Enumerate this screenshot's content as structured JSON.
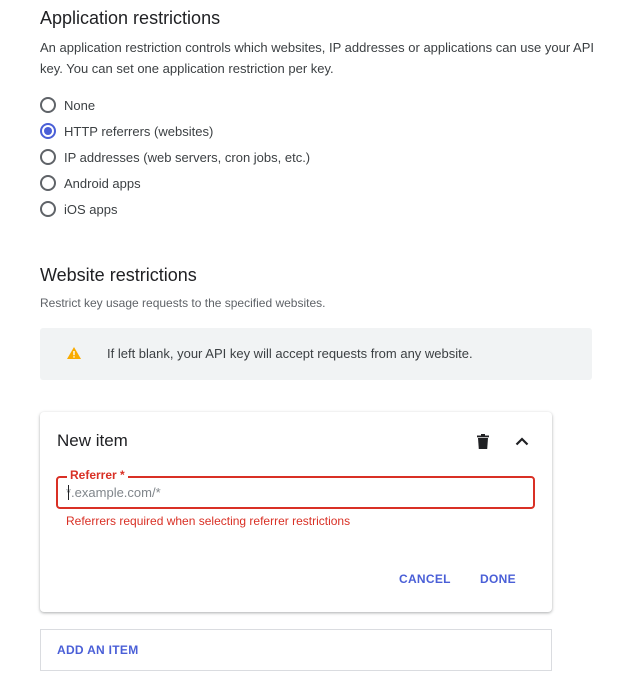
{
  "app_restrictions": {
    "title": "Application restrictions",
    "description": "An application restriction controls which websites, IP addresses or applications can use your API key. You can set one application restriction per key.",
    "options": [
      {
        "label": "None",
        "selected": false
      },
      {
        "label": "HTTP referrers (websites)",
        "selected": true
      },
      {
        "label": "IP addresses (web servers, cron jobs, etc.)",
        "selected": false
      },
      {
        "label": "Android apps",
        "selected": false
      },
      {
        "label": "iOS apps",
        "selected": false
      }
    ]
  },
  "website_restrictions": {
    "title": "Website restrictions",
    "description": "Restrict key usage requests to the specified websites.",
    "warning": {
      "icon": "warning-icon",
      "text": "If left blank, your API key will accept requests from any website."
    }
  },
  "item_card": {
    "title": "New item",
    "delete_icon": "trash-icon",
    "collapse_icon": "chevron-up-icon",
    "referrer_field": {
      "label": "Referrer *",
      "placeholder": "*.example.com/*",
      "value": ""
    },
    "error": "Referrers required when selecting referrer restrictions",
    "cancel_label": "CANCEL",
    "done_label": "DONE"
  },
  "add_item_label": "ADD AN ITEM",
  "colors": {
    "accent": "#4a5fd7",
    "error": "#d93025",
    "warning": "#f9ab00",
    "banner_bg": "#f1f3f4"
  }
}
